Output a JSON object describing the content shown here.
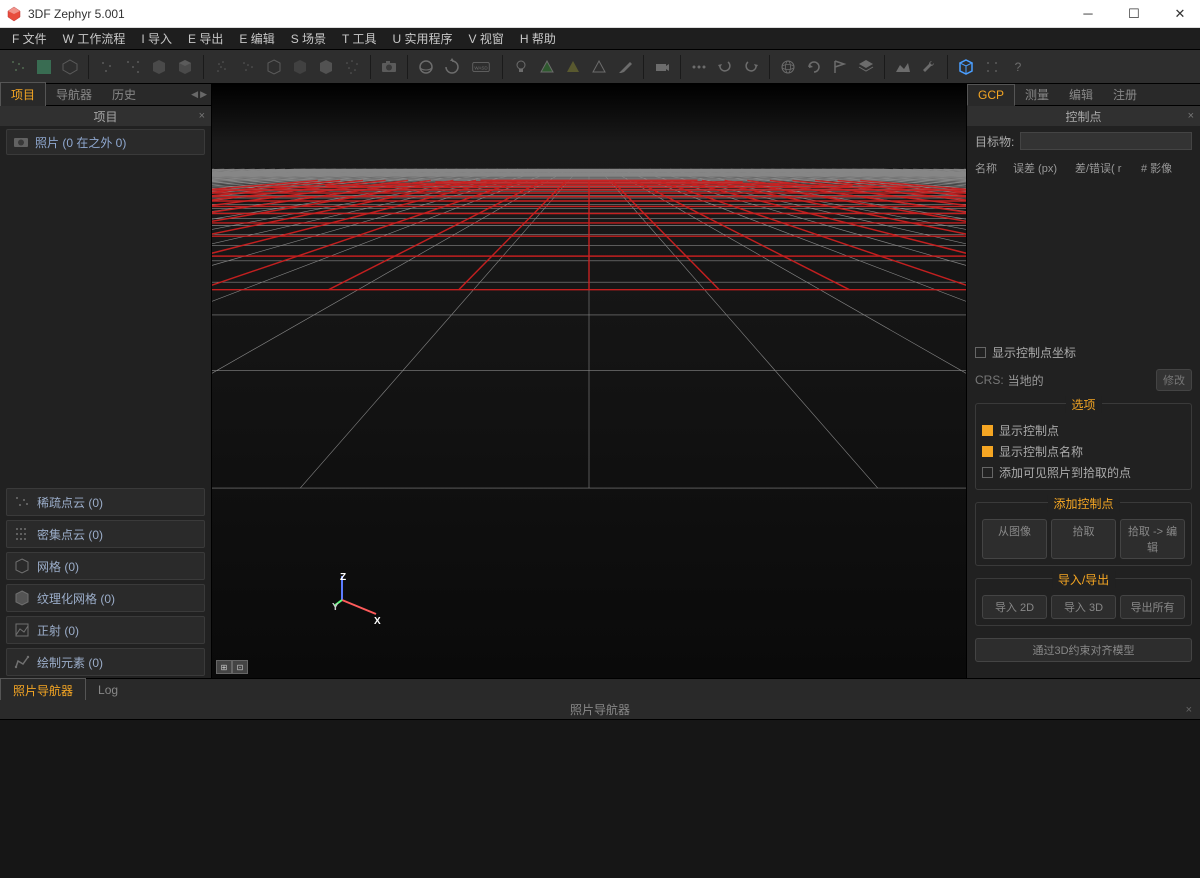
{
  "app": {
    "title": "3DF Zephyr 5.001"
  },
  "menu": {
    "file": "F 文件",
    "workflow": "W 工作流程",
    "import": "I 导入",
    "export": "E 导出",
    "edit": "E 编辑",
    "scene": "S 场景",
    "tools": "T 工具",
    "utilities": "U 实用程序",
    "view": "V 视窗",
    "help": "H 帮助"
  },
  "left": {
    "tabs": {
      "project": "项目",
      "navigator": "导航器",
      "history": "历史"
    },
    "header": "项目",
    "photos": "照片 (0 在之外 0)",
    "cats": {
      "sparse": "稀疏点云 (0)",
      "dense": "密集点云 (0)",
      "mesh": "网格 (0)",
      "texmesh": "纹理化网格 (0)",
      "ortho": "正射 (0)",
      "draw": "绘制元素 (0)"
    }
  },
  "viewport": {
    "axis_x": "X",
    "axis_y": "Y",
    "axis_z": "Z"
  },
  "right": {
    "tabs": {
      "gcp": "GCP",
      "measure": "测量",
      "edit": "编辑",
      "register": "注册"
    },
    "header": "控制点",
    "target_label": "目标物:",
    "cols": {
      "name": "名称",
      "errpx": "误差 (px)",
      "errr": "差/错误( r",
      "nimg": "# 影像"
    },
    "show_coords": "显示控制点坐标",
    "crs_label": "CRS:",
    "crs_value": "当地的",
    "crs_modify": "修改",
    "section_options": "选项",
    "opt_show_gcp": "显示控制点",
    "opt_show_names": "显示控制点名称",
    "opt_add_visible": "添加可见照片到拾取的点",
    "section_add": "添加控制点",
    "btn_fromimg": "从图像",
    "btn_pick": "拾取",
    "btn_pickedit": "拾取 -> 编辑",
    "section_io": "导入/导出",
    "btn_imp2d": "导入 2D",
    "btn_imp3d": "导入 3D",
    "btn_expall": "导出所有",
    "btn_align3d": "通过3D约束对齐模型"
  },
  "bottom": {
    "tabs": {
      "photonav": "照片导航器",
      "log": "Log"
    },
    "header": "照片导航器"
  }
}
